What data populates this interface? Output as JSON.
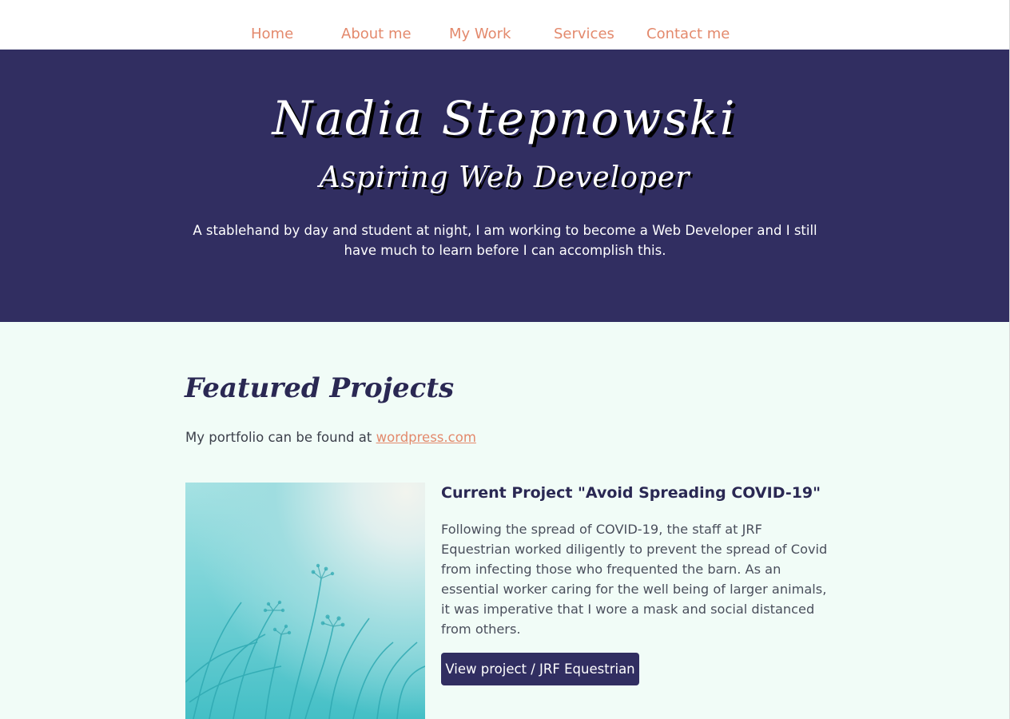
{
  "nav": {
    "items": [
      {
        "label": "Home"
      },
      {
        "label": "About me"
      },
      {
        "label": "My Work"
      },
      {
        "label": "Services"
      },
      {
        "label": "Contact me"
      }
    ]
  },
  "hero": {
    "title": "Nadia Stepnowski",
    "subtitle": "Aspiring Web Developer",
    "blurb": "A stablehand by day and student at night, I am working to become a Web Developer and I still have much to learn before I can accomplish this."
  },
  "featured": {
    "heading": "Featured Projects",
    "portfolio_prefix": "My portfolio can be found at ",
    "portfolio_link": "wordpress.com"
  },
  "project": {
    "title": "Current Project \"Avoid Spreading COVID-19\"",
    "description": "Following the spread of COVID-19, the staff at JRF Equestrian worked diligently to prevent the spread of Covid from infecting those who frequented the barn. As an essential worker caring for the well being of larger animals, it was imperative that I wore a mask and social distanced from others.",
    "button_label": "View project / JRF Equestrian",
    "image_icon": "meadow-flowers-photo"
  },
  "colors": {
    "accent": "#e3896c",
    "brand_dark": "#312e61",
    "background": "#f1fcf7"
  }
}
